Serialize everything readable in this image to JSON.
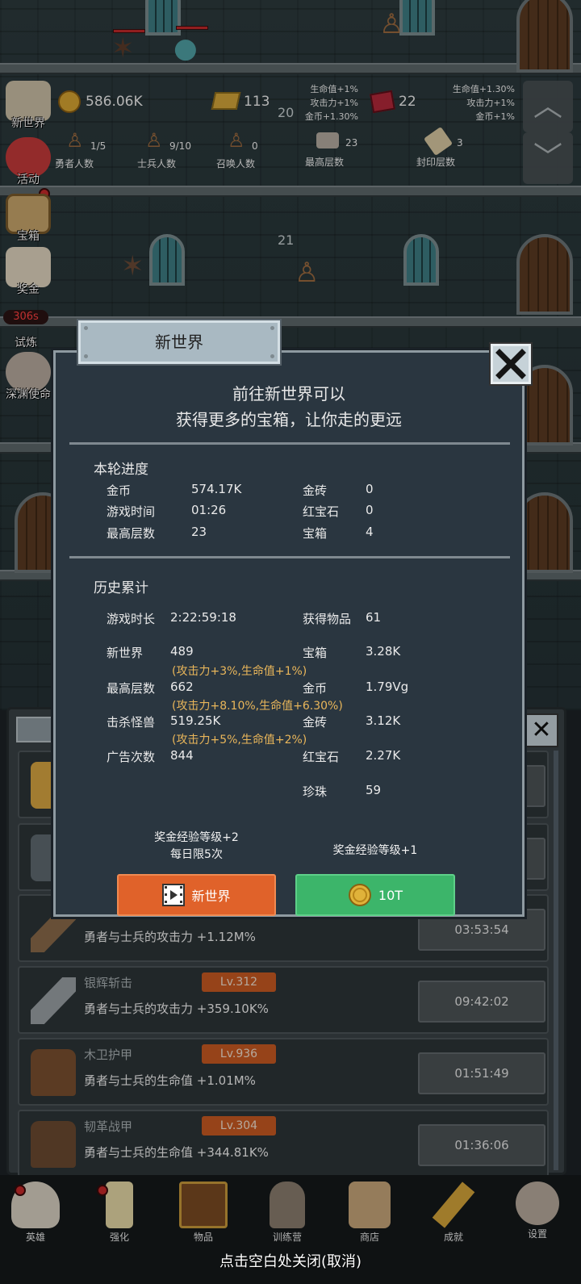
{
  "floors": {
    "floor_20": "20",
    "floor_21": "21"
  },
  "resources": {
    "gold": "586.06K",
    "gold_bar": "113",
    "ruby": "22",
    "bonus_left": [
      "生命值+1%",
      "攻击力+1%",
      "金币+1.30%"
    ],
    "bonus_right": [
      "生命值+1.30%",
      "攻击力+1%",
      "金币+1%"
    ]
  },
  "counts": {
    "heroes_value": "1/5",
    "heroes_label": "勇者人数",
    "soldiers_value": "9/10",
    "soldiers_label": "士兵人数",
    "summon_value": "0",
    "summon_label": "召唤人数",
    "max_floor_value": "23",
    "max_floor_label": "最高层数",
    "seal_value": "3",
    "seal_label": "封印层数"
  },
  "side_menu": {
    "new_world": "新世界",
    "event": "活动",
    "chest": "宝箱",
    "reward": "奖金",
    "trial_timer": "306s",
    "trial": "试炼",
    "abyss": "深渊使命"
  },
  "modal": {
    "title": "新世界",
    "intro_line1": "前往新世界可以",
    "intro_line2": "获得更多的宝箱，让你走的更远",
    "round_title": "本轮进度",
    "round": {
      "gold_label": "金币",
      "gold_value": "574.17K",
      "gold_bar_label": "金砖",
      "gold_bar_value": "0",
      "time_label": "游戏时间",
      "time_value": "01:26",
      "ruby_label": "红宝石",
      "ruby_value": "0",
      "max_floor_label": "最高层数",
      "max_floor_value": "23",
      "chest_label": "宝箱",
      "chest_value": "4"
    },
    "history_title": "历史累计",
    "history": {
      "duration_label": "游戏时长",
      "duration_value": "2:22:59:18",
      "items_label": "获得物品",
      "items_value": "61",
      "newworld_label": "新世界",
      "newworld_value": "489",
      "newworld_bonus": "(攻击力+3%,生命值+1%)",
      "chest_label": "宝箱",
      "chest_value": "3.28K",
      "maxfloor_label": "最高层数",
      "maxfloor_value": "662",
      "maxfloor_bonus": "(攻击力+8.10%,生命值+6.30%)",
      "gold_label": "金币",
      "gold_value": "1.79Vg",
      "kills_label": "击杀怪兽",
      "kills_value": "519.25K",
      "kills_bonus": "(攻击力+5%,生命值+2%)",
      "goldbar_label": "金砖",
      "goldbar_value": "3.12K",
      "ads_label": "广告次数",
      "ads_value": "844",
      "ruby_label": "红宝石",
      "ruby_value": "2.27K",
      "pearl_label": "珍珠",
      "pearl_value": "59"
    },
    "left_note_1": "奖金经验等级+2",
    "left_note_2": "每日限5次",
    "right_note": "奖金经验等级+1",
    "btn_video": "新世界",
    "btn_coin": "10T"
  },
  "list": [
    {
      "name": "",
      "desc": "勇者与士兵的攻击力 +1.12M%",
      "lv": "",
      "timer": "03:53:54"
    },
    {
      "name": "银辉斩击",
      "desc": "勇者与士兵的攻击力 +359.10K%",
      "lv": "Lv.312",
      "timer": "09:42:02"
    },
    {
      "name": "木卫护甲",
      "desc": "勇者与士兵的生命值 +1.01M%",
      "lv": "Lv.936",
      "timer": "01:51:49"
    },
    {
      "name": "韧革战甲",
      "desc": "勇者与士兵的生命值 +344.81K%",
      "lv": "Lv.304",
      "timer": "01:36:06"
    }
  ],
  "bottom_nav": {
    "hero": "英雄",
    "enhance": "强化",
    "items": "物品",
    "training": "训练营",
    "shop": "商店",
    "achievement": "成就",
    "settings": "设置"
  },
  "close_hint": "点击空白处关闭(取消)",
  "colors": {
    "accent_orange": "#e0622a",
    "accent_green": "#3cb56a",
    "bonus_gold": "#e9b65a",
    "lv_badge": "#c85a22"
  }
}
